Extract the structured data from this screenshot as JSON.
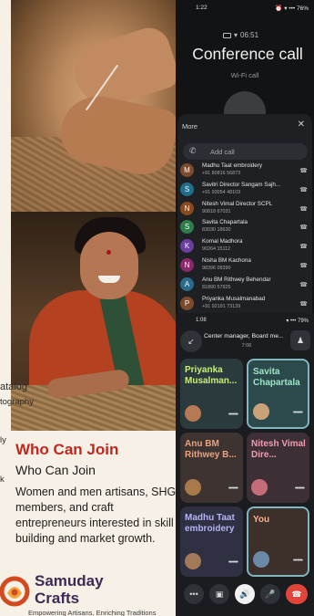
{
  "poster": {
    "cut_catalog": "atalog",
    "cut_tography": "tography",
    "cut_ly": "ly",
    "cut_k": "k",
    "who_heading": "Who Can Join",
    "who_subheading": "Who Can Join",
    "who_body": "Women and men artisans, SHG members, and craft entrepreneurs interested in skill building and market growth.",
    "brand_line1": "Samuday",
    "brand_line2": "Crafts",
    "tagline": "Empowering Artisans, Enriching Traditions",
    "colors": {
      "heading": "#c0281d",
      "brand": "#3d2a55"
    }
  },
  "call_screen": {
    "status_time": "1:22",
    "status_right": "⏰ ▾ ••• 76%",
    "timer": "06:51",
    "title": "Conference call",
    "subtitle": "Wi-Fi call",
    "sheet": {
      "title": "More",
      "close_icon": "close-icon",
      "add_call_label": "Add call",
      "participants": [
        {
          "initial": "M",
          "name": "Madhu Taat embroidery",
          "number": "+91 80816 56873",
          "color": "#7c4a2d"
        },
        {
          "initial": "S",
          "name": "Savitri Director Sangam Sajh...",
          "number": "+91 93054 48103",
          "color": "#1f6f8a"
        },
        {
          "initial": "N",
          "name": "Nitesh Vimal Director SCPL",
          "number": "90818 67031",
          "color": "#8a4a1f"
        },
        {
          "initial": "S",
          "name": "Savita Chapartala",
          "number": "83030 18630",
          "color": "#2e7d4a"
        },
        {
          "initial": "K",
          "name": "Komal Madhora",
          "number": "90264 15112",
          "color": "#6a3fa0"
        },
        {
          "initial": "N",
          "name": "Nisha  BM Kachona",
          "number": "98396 08390",
          "color": "#8a2a6a"
        },
        {
          "initial": "A",
          "name": "Anu BM Rithwey Behendar",
          "number": "81890 57925",
          "color": "#2a6a8a"
        },
        {
          "initial": "P",
          "name": "Priyanka Musalmanabad",
          "number": "+91 92191 73139",
          "color": "#7c4a2d"
        }
      ]
    }
  },
  "meet_screen": {
    "status_time": "1:08",
    "status_right": "▾ ••• 79%",
    "title": "Center manager, Board me...",
    "time": "7:06",
    "tiles": [
      {
        "name": "Priyanka Musalman...",
        "name_color": "#c8ef7a",
        "bg": "#2b3b3d",
        "avatar": "#b57a54",
        "highlight": false
      },
      {
        "name": "Savita Chapartala",
        "name_color": "#9ce6c6",
        "bg": "#2c4a4c",
        "avatar": "#c9a27a",
        "highlight": true
      },
      {
        "name": "Anu BM Rithwey B...",
        "name_color": "#f0a07a",
        "bg": "#3d3331",
        "avatar": "#a87a4a",
        "highlight": false
      },
      {
        "name": "Nitesh Vimal Dire...",
        "name_color": "#f59ab0",
        "bg": "#3c3036",
        "avatar": "#c56c7a",
        "highlight": false
      },
      {
        "name": "Madhu Taat embroidery",
        "name_color": "#b8b2f7",
        "bg": "#2f3041",
        "avatar": "#a27a5a",
        "highlight": false
      },
      {
        "name": "You",
        "name_color": "#f7b08a",
        "bg": "#3d2f2a",
        "avatar": "#6a8aa8",
        "highlight": true
      }
    ],
    "controls": {
      "more": "•••",
      "camera_icon": "camera-off-icon",
      "speaker_icon": "speaker-icon",
      "mic_icon": "mic-off-icon",
      "end_icon": "end-call-icon"
    }
  }
}
